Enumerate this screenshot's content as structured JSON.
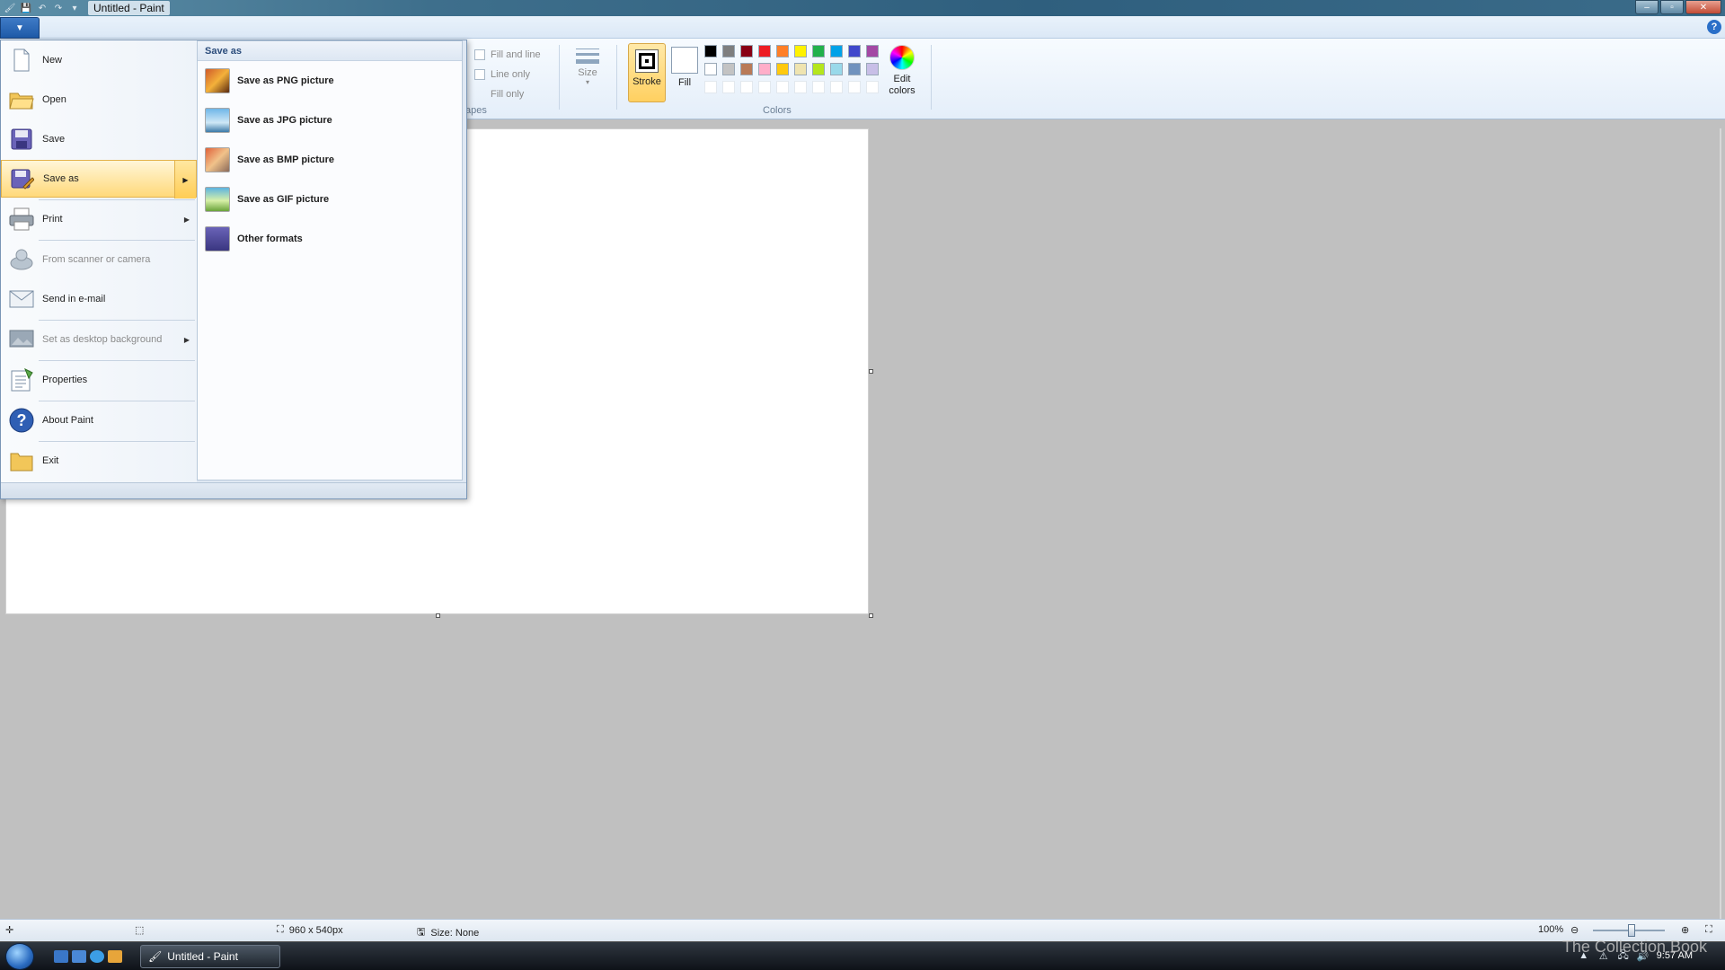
{
  "window": {
    "title": "Untitled - Paint",
    "controls": {
      "minimize": "–",
      "maximize": "▫",
      "close": "✕"
    }
  },
  "qat": {
    "save_icon": "save-icon",
    "undo_icon": "undo-icon",
    "redo_icon": "redo-icon",
    "customize_icon": "chevron-down-icon"
  },
  "help": {
    "label": "?"
  },
  "ribbon": {
    "shape_options": [
      "Fill and line",
      "Line only",
      "Fill only"
    ],
    "shapes_group_label": "apes",
    "size_label": "Size",
    "stroke_label": "Stroke",
    "fill_label": "Fill",
    "colors_group_label": "Colors",
    "edit_colors_label_1": "Edit",
    "edit_colors_label_2": "colors",
    "palette_row1": [
      "#000000",
      "#7f7f7f",
      "#880015",
      "#ed1c24",
      "#ff7f27",
      "#fff200",
      "#22b14c",
      "#00a2e8",
      "#3f48cc",
      "#a349a4"
    ],
    "palette_row2": [
      "#ffffff",
      "#c3c3c3",
      "#b97a57",
      "#ffaec9",
      "#ffc90e",
      "#efe4b0",
      "#b5e61d",
      "#99d9ea",
      "#7092be",
      "#c8bfe7"
    ]
  },
  "app_menu": {
    "items": [
      {
        "label": "New",
        "icon": "new-file-icon"
      },
      {
        "label": "Open",
        "icon": "open-folder-icon"
      },
      {
        "label": "Save",
        "icon": "save-icon"
      },
      {
        "label": "Save as",
        "icon": "save-as-icon"
      },
      {
        "label": "Print",
        "icon": "printer-icon"
      },
      {
        "label": "From scanner or camera",
        "icon": "scanner-icon"
      },
      {
        "label": "Send in e-mail",
        "icon": "email-icon"
      },
      {
        "label": "Set as desktop background",
        "icon": "desktop-icon"
      },
      {
        "label": "Properties",
        "icon": "properties-icon"
      },
      {
        "label": "About Paint",
        "icon": "help-icon"
      },
      {
        "label": "Exit",
        "icon": "exit-icon"
      }
    ],
    "submenu_title": "Save as",
    "submenu_items": [
      {
        "label": "Save as PNG picture",
        "icon": "png-icon"
      },
      {
        "label": "Save as JPG picture",
        "icon": "jpg-icon"
      },
      {
        "label": "Save as BMP picture",
        "icon": "bmp-icon"
      },
      {
        "label": "Save as GIF picture",
        "icon": "gif-icon"
      },
      {
        "label": "Other formats",
        "icon": "other-formats-icon"
      }
    ]
  },
  "status": {
    "canvas_size": "960 x 540px",
    "selection_size": "Size: None",
    "zoom": "100%",
    "zoom_level": 1.0
  },
  "taskbar": {
    "task_label": "Untitled - Paint",
    "clock": "9:57 AM"
  },
  "watermark": "The Collection Book"
}
